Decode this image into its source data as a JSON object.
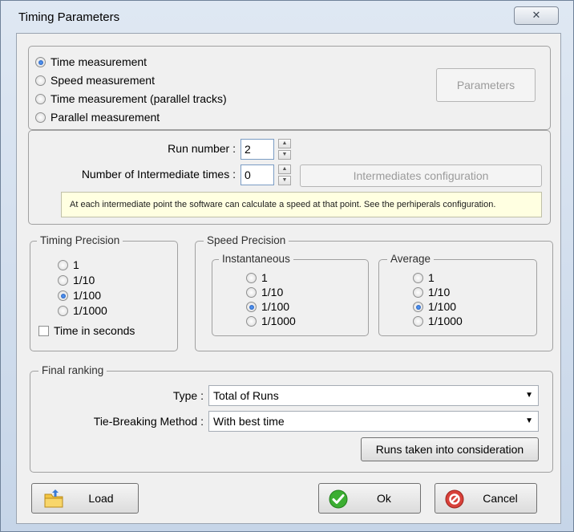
{
  "window": {
    "title": "Timing Parameters",
    "close_glyph": "✕"
  },
  "measurement": {
    "options": [
      {
        "label": "Time measurement",
        "selected": true
      },
      {
        "label": "Speed measurement",
        "selected": false
      },
      {
        "label": "Time measurement (parallel tracks)",
        "selected": false
      },
      {
        "label": "Parallel measurement",
        "selected": false
      }
    ],
    "parameters_button": "Parameters"
  },
  "runs": {
    "run_number_label": "Run number :",
    "run_number_value": "2",
    "intermediate_label": "Number of Intermediate times :",
    "intermediate_value": "0",
    "intermediates_button": "Intermediates configuration",
    "info_text": "At each intermediate point the software can calculate a speed at that point. See the perhiperals configuration."
  },
  "timing_precision": {
    "legend": "Timing Precision",
    "options": [
      "1",
      "1/10",
      "1/100",
      "1/1000"
    ],
    "selected_index": 2,
    "seconds_label": "Time in seconds",
    "seconds_checked": false
  },
  "speed_precision": {
    "legend": "Speed Precision",
    "instantaneous": {
      "legend": "Instantaneous",
      "options": [
        "1",
        "1/10",
        "1/100",
        "1/1000"
      ],
      "selected_index": 2
    },
    "average": {
      "legend": "Average",
      "options": [
        "1",
        "1/10",
        "1/100",
        "1/1000"
      ],
      "selected_index": 2
    }
  },
  "final_ranking": {
    "legend": "Final ranking",
    "type_label": "Type :",
    "type_value": "Total of Runs",
    "tie_label": "Tie-Breaking Method :",
    "tie_value": "With best time",
    "runs_button": "Runs taken into consideration"
  },
  "footer": {
    "load_label": "Load",
    "ok_label": "Ok",
    "cancel_label": "Cancel"
  },
  "icons": {
    "load": "folder-icon",
    "ok": "check-icon",
    "cancel": "cancel-icon"
  },
  "colors": {
    "ok_green": "#3cae32",
    "cancel_red": "#d8413a",
    "folder_yellow": "#f3c542",
    "info_bg": "#ffffe1"
  }
}
